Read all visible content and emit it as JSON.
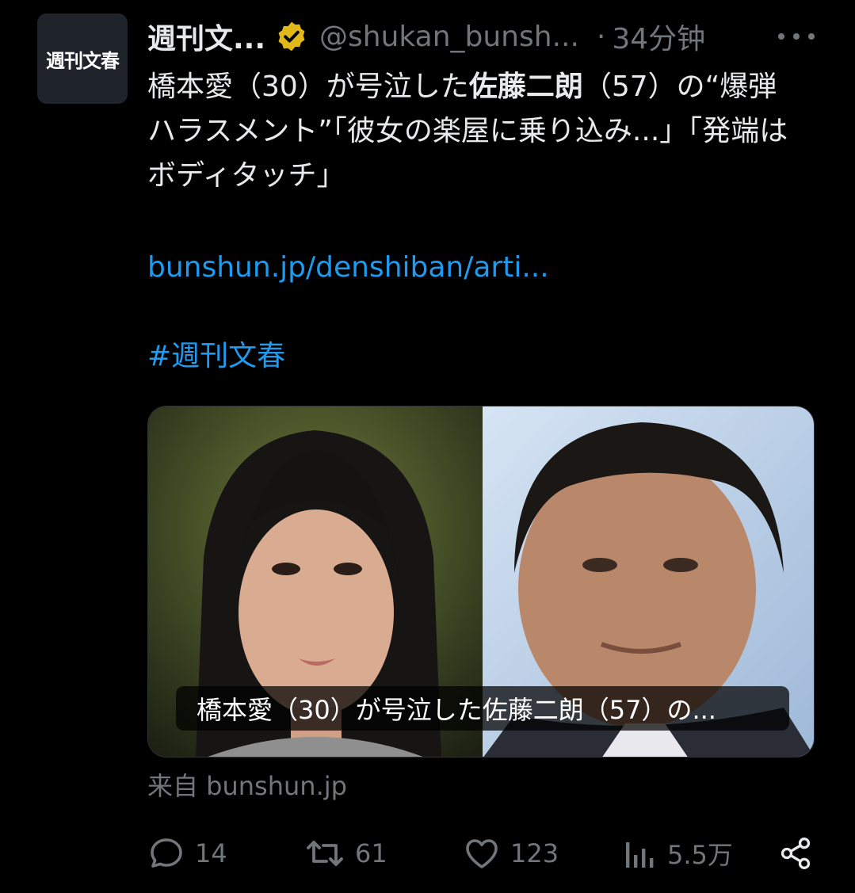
{
  "author": {
    "avatar_text": "週刊文春",
    "display_name": "週刊文...",
    "handle": "@shukan_bunsh...",
    "separator": "·",
    "time": "34分钟"
  },
  "tweet": {
    "text_line1_a": "橋本愛（30）が号泣した",
    "text_line1_bold": "佐藤二朗",
    "text_line1_b": "（57）の“爆弾ハラスメント”「彼女の楽屋に乗り込み...」「発端はボディタッチ」",
    "link": "bunshun.jp/denshiban/arti...",
    "hashtag": "#週刊文春"
  },
  "card": {
    "caption": "橋本愛（30）が号泣した佐藤二朗（57）の..."
  },
  "source": "来自 bunshun.jp",
  "actions": {
    "replies": "14",
    "reposts": "61",
    "likes": "123",
    "views": "5.5万"
  },
  "colors": {
    "background": "#000000",
    "text": "#e7e9ea",
    "muted": "#71767b",
    "link": "#1d9bf0",
    "verified_gold": "#e2b719"
  }
}
